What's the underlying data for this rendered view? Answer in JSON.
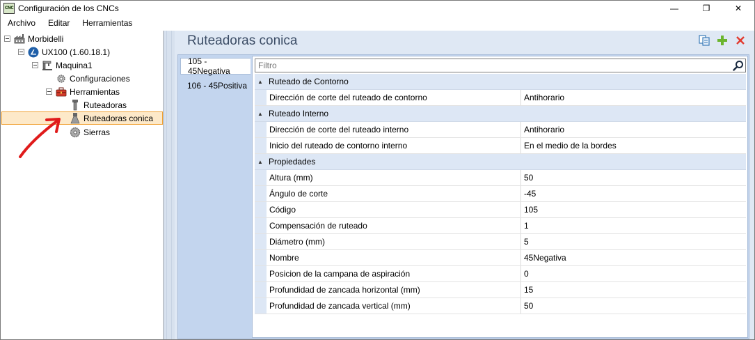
{
  "window": {
    "title": "Configuración de los CNCs",
    "app_icon": "CNC",
    "minimize_glyph": "—",
    "restore_glyph": "❐",
    "close_glyph": "✕"
  },
  "menu": {
    "items": [
      "Archivo",
      "Editar",
      "Herramientas"
    ]
  },
  "tree": {
    "nodes": [
      {
        "label": "Morbidelli",
        "icon": "factory-icon"
      },
      {
        "label": "UX100 (1.60.18.1)",
        "icon": "machine-logo-icon"
      },
      {
        "label": "Maquina1",
        "icon": "cnc-machine-icon"
      },
      {
        "label": "Configuraciones",
        "icon": "gear-icon"
      },
      {
        "label": "Herramientas",
        "icon": "toolbox-icon"
      },
      {
        "label": "Ruteadoras",
        "icon": "router-bit-icon"
      },
      {
        "label": "Ruteadoras conica",
        "icon": "conical-bit-icon",
        "selected": true
      },
      {
        "label": "Sierras",
        "icon": "saw-blade-icon"
      }
    ]
  },
  "main": {
    "title": "Ruteadoras conica",
    "actions": {
      "copy_icon": "copy-icon",
      "add_icon": "add-icon",
      "delete_icon": "delete-icon"
    },
    "tabs": [
      {
        "label": "105 - 45Negativa",
        "active": true
      },
      {
        "label": "106 - 45Positiva",
        "active": false
      }
    ],
    "filter": {
      "placeholder": "Filtro",
      "value": ""
    },
    "categories": [
      {
        "label": "Ruteado de Contorno",
        "rows": [
          {
            "name": "Dirección de corte del ruteado de contorno",
            "value": "Antihorario"
          }
        ]
      },
      {
        "label": "Ruteado Interno",
        "rows": [
          {
            "name": "Dirección de corte del ruteado interno",
            "value": "Antihorario"
          },
          {
            "name": "Inicio del ruteado de contorno interno",
            "value": "En el medio de la bordes"
          }
        ]
      },
      {
        "label": "Propiedades",
        "rows": [
          {
            "name": "Altura (mm)",
            "value": "50"
          },
          {
            "name": "Ángulo de corte",
            "value": "-45"
          },
          {
            "name": "Código",
            "value": "105"
          },
          {
            "name": "Compensación de ruteado",
            "value": "1"
          },
          {
            "name": "Diámetro (mm)",
            "value": "5"
          },
          {
            "name": "Nombre",
            "value": "45Negativa"
          },
          {
            "name": "Posicion de la campana de aspiración",
            "value": "0"
          },
          {
            "name": "Profundidad de zancada horizontal (mm)",
            "value": "15"
          },
          {
            "name": "Profundidad de zancada vertical (mm)",
            "value": "50"
          }
        ]
      }
    ]
  },
  "colors": {
    "accent": "#3c4d66",
    "panel_bg": "#dfe8f4",
    "selection_border": "#f0a030",
    "selection_fill": "#fde9c9",
    "annotation": "#e01b1b"
  }
}
